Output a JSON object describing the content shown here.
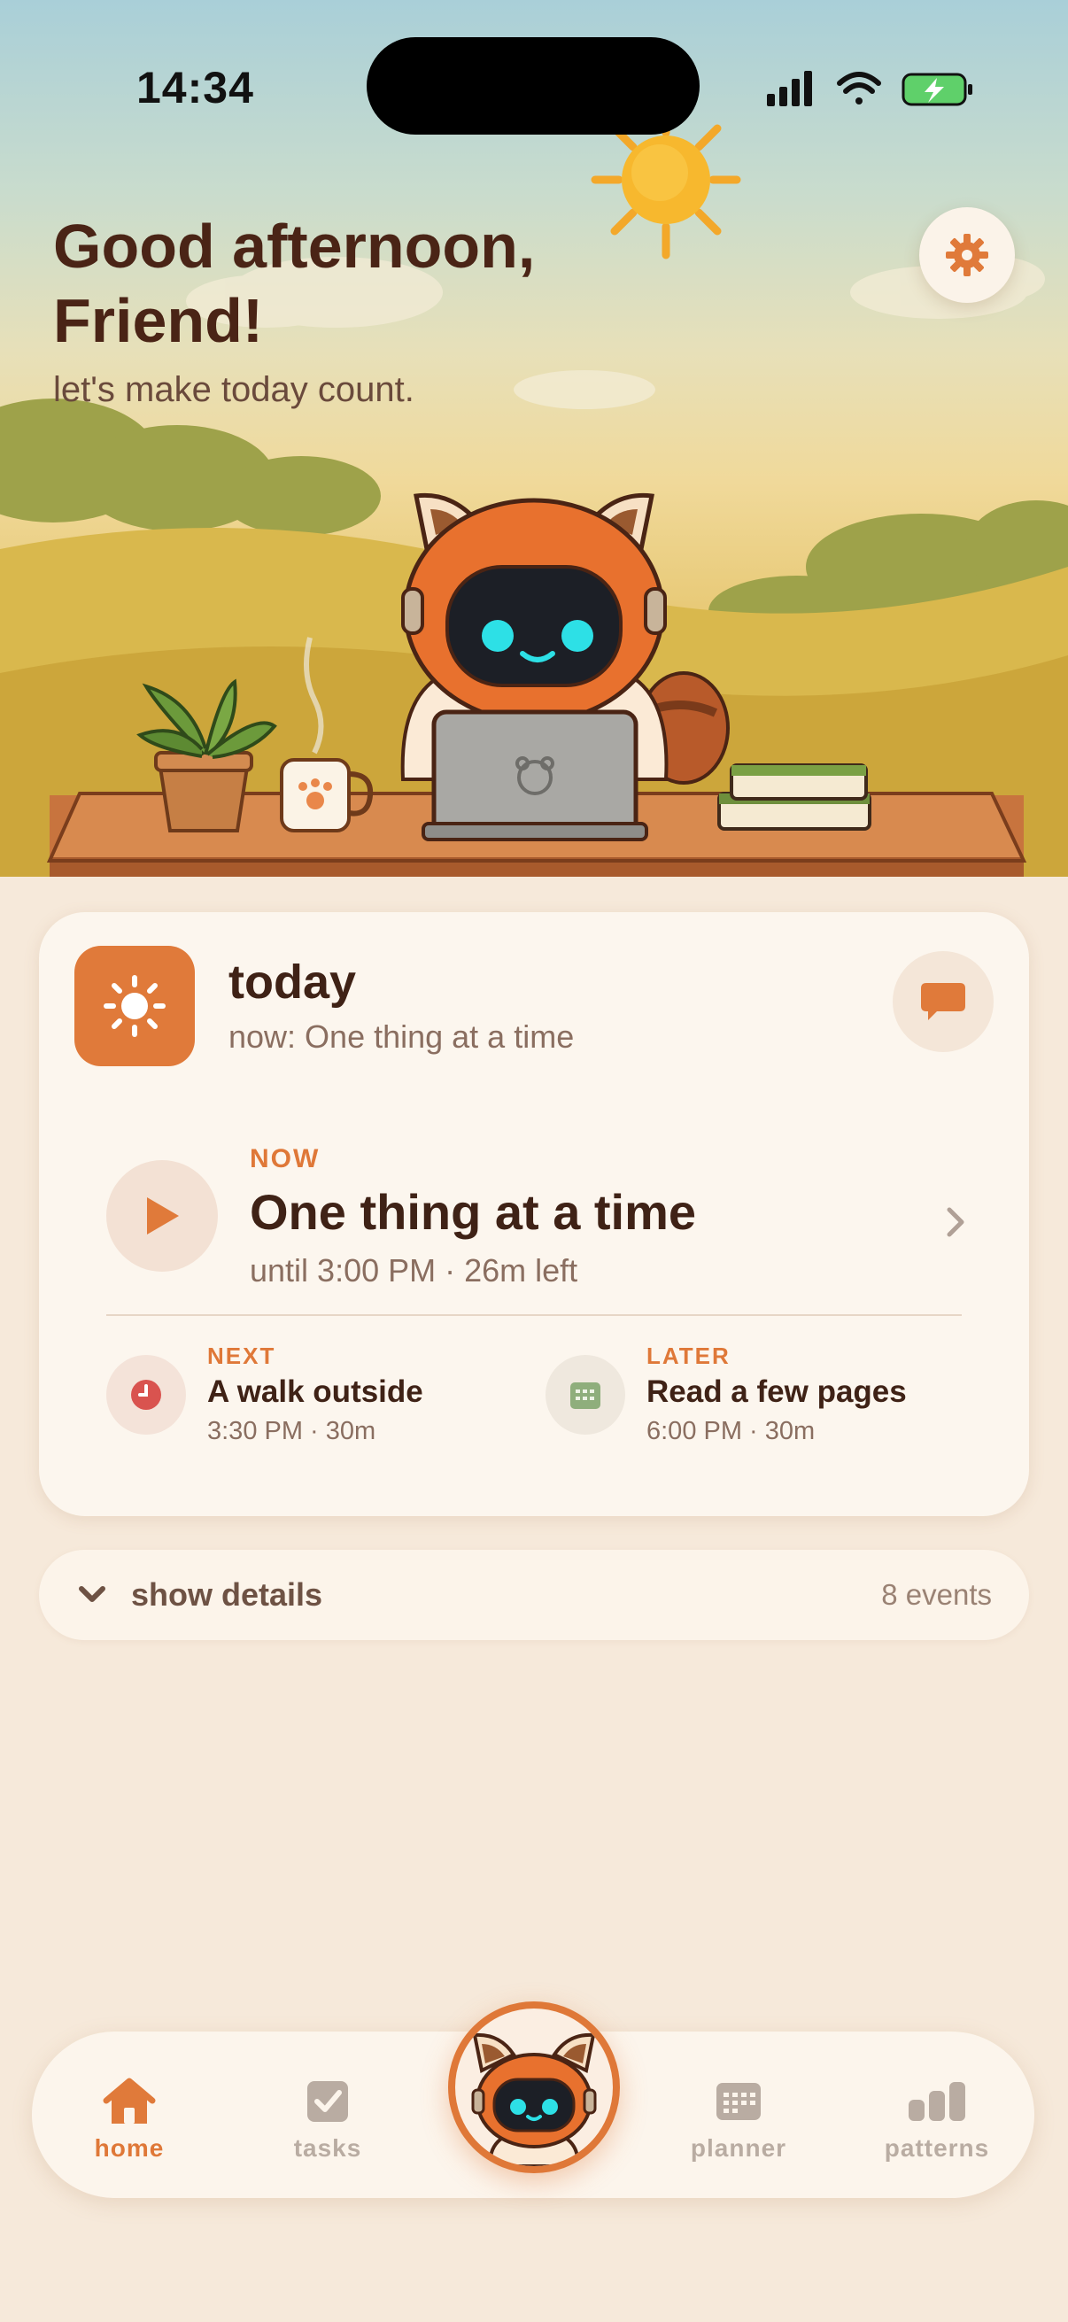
{
  "status_bar": {
    "time": "14:34",
    "icons": [
      "cellular-signal-icon",
      "wifi-icon",
      "battery-charging-icon"
    ]
  },
  "header": {
    "greeting_line1": "Good afternoon,",
    "greeting_line2": "Friend!",
    "subtitle": "let's make today count.",
    "settings_icon": "gear-icon"
  },
  "today_card": {
    "title": "today",
    "subtitle": "now: One thing at a time",
    "icon": "sun-icon",
    "chat_icon": "chat-bubble-icon",
    "now": {
      "label": "NOW",
      "title": "One thing at a time",
      "time": "until 3:00 PM · 26m left"
    },
    "next": {
      "label": "NEXT",
      "title": "A walk outside",
      "time": "3:30 PM · 30m",
      "icon": "clock-icon"
    },
    "later": {
      "label": "LATER",
      "title": "Read a few pages",
      "time": "6:00 PM · 30m",
      "icon": "calendar-icon"
    }
  },
  "details": {
    "label": "show details",
    "count": "8 events"
  },
  "nav": {
    "items": [
      {
        "label": "home",
        "icon": "home-icon",
        "active": true
      },
      {
        "label": "tasks",
        "icon": "checkbox-icon",
        "active": false
      },
      {
        "label": "planner",
        "icon": "calendar-icon",
        "active": false
      },
      {
        "label": "patterns",
        "icon": "bar-chart-icon",
        "active": false
      }
    ],
    "center_icon": "robot-mascot-icon"
  },
  "colors": {
    "accent": "#df7838",
    "background": "#f6e9da",
    "card": "#fcf6ee",
    "text_dark": "#3f2216",
    "text_muted": "#8a6e60"
  }
}
